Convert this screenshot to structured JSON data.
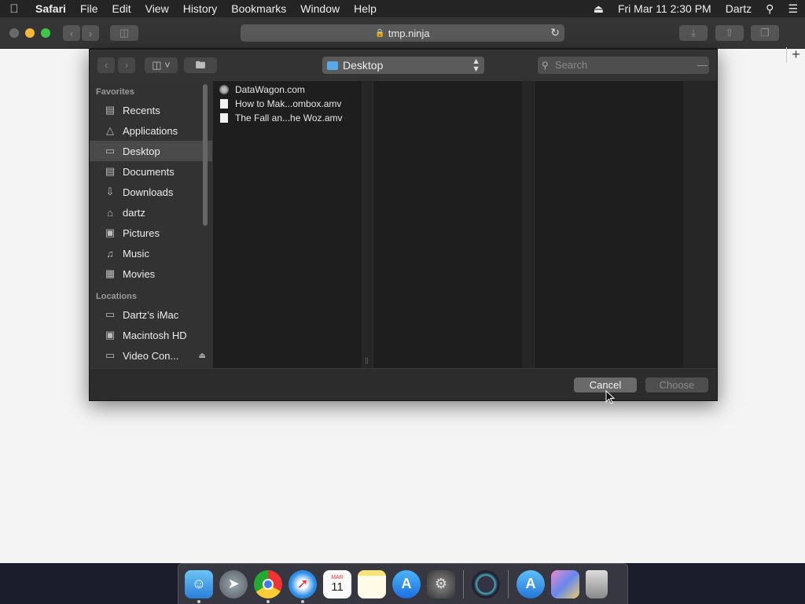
{
  "menubar": {
    "app": "Safari",
    "items": [
      "File",
      "Edit",
      "View",
      "History",
      "Bookmarks",
      "Window",
      "Help"
    ],
    "clock": "Fri Mar 11  2:30 PM",
    "user": "Dartz"
  },
  "browser": {
    "url": "tmp.ninja"
  },
  "dialog": {
    "location": "Desktop",
    "search_placeholder": "Search",
    "favorites_header": "Favorites",
    "favorites": [
      "Recents",
      "Applications",
      "Desktop",
      "Documents",
      "Downloads",
      "dartz",
      "Pictures",
      "Music",
      "Movies"
    ],
    "locations_header": "Locations",
    "locations": [
      "Dartz’s iMac",
      "Macintosh HD",
      "Video Con..."
    ],
    "files": [
      "DataWagon.com",
      "How to Mak...ombox.amv",
      "The Fall an...he Woz.amv"
    ],
    "cancel_label": "Cancel",
    "choose_label": "Choose"
  },
  "dock": {
    "icons": [
      "finder-icon",
      "launchpad-icon",
      "chrome-icon",
      "safari-icon",
      "calendar-icon",
      "notes-icon",
      "app-store-icon",
      "system-preferences-icon",
      "quicktime-icon",
      "applications-folder-icon",
      "documents-stack-icon",
      "trash-icon"
    ],
    "calendar_month": "MAR",
    "calendar_day": "11"
  }
}
